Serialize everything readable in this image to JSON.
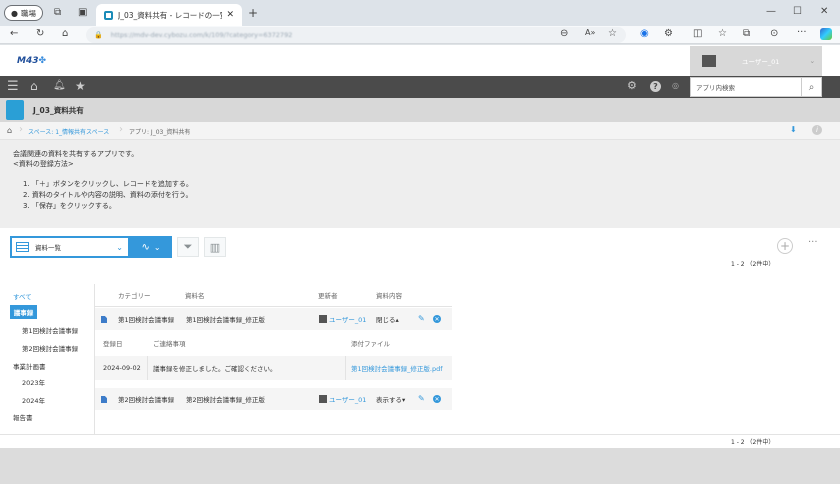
{
  "browser": {
    "profile": "職場",
    "tab_title": "J_03_資料共有 - レコードの一覧",
    "url": "https://mdv-dev.cybozu.com/k/109/?category=6372792"
  },
  "app": {
    "logo": "M43",
    "user_name": "ユーザー_01",
    "search_placeholder": "アプリ内検索",
    "title": "J_03_資料共有",
    "breadcrumb_space": "スペース: 1_情報共有スペース",
    "breadcrumb_app": "アプリ: J_03_資料共有"
  },
  "description": {
    "line1": "会議関連の資料を共有するアプリです。",
    "line2": "<資料の登録方法>",
    "steps": [
      "1. 「＋」ボタンをクリックし、レコードを追加する。",
      "2. 資料のタイトルや内容の説明、資料の添付を行う。",
      "3. 「保存」をクリックする。"
    ]
  },
  "toolbar": {
    "view_name": "資料一覧",
    "count_top": "1 - 2 （2件中）",
    "count_bottom": "1 - 2 （2件中）"
  },
  "sidebar": {
    "all": "すべて",
    "items": [
      {
        "label": "議事録",
        "level": 0,
        "selected": true
      },
      {
        "label": "第1回検討会議事録",
        "level": 1
      },
      {
        "label": "第2回検討会議事録",
        "level": 1
      },
      {
        "label": "事業計画書",
        "level": 0
      },
      {
        "label": "2023年",
        "level": 1
      },
      {
        "label": "2024年",
        "level": 1
      },
      {
        "label": "報告書",
        "level": 0
      }
    ]
  },
  "table": {
    "headers": [
      "カテゴリー",
      "資料名",
      "更新者",
      "資料内容"
    ],
    "rows": [
      {
        "category": "第1回検討会議事録",
        "name": "第1回検討会議事録_修正版",
        "updater": "ユーザー_01",
        "content": "閉じる▴"
      },
      {
        "category": "第2回検討会議事録",
        "name": "第2回検討会議事録_修正版",
        "updater": "ユーザー_01",
        "content": "表示する▾"
      }
    ],
    "sub_headers": [
      "登録日",
      "ご連絡事項",
      "添付ファイル"
    ],
    "sub_row": {
      "date": "2024-09-02",
      "note": "議事録を修正しました。ご確認ください。",
      "file": "第1回検討会議事録_修正版.pdf"
    }
  },
  "colors": {
    "accent": "#3498db",
    "navbar": "#4b4b4b",
    "selected": "#3498db"
  }
}
